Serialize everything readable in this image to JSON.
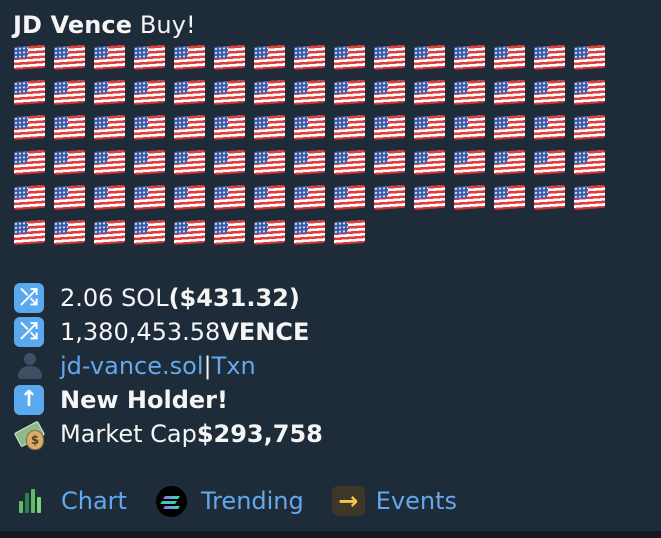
{
  "message": {
    "title": {
      "name": "JD Vence",
      "suffix": " Buy!"
    },
    "flags": {
      "count": 84,
      "per_row": 15,
      "icon": "us-flag-icon"
    },
    "details": [
      {
        "icon": "shuffle-icon",
        "text": "2.06 SOL ",
        "bold": "($431.32)",
        "link": ""
      },
      {
        "icon": "shuffle-icon",
        "text": "1,380,453.58 ",
        "bold": "VENCE",
        "link": ""
      },
      {
        "icon": "person-icon",
        "text": "",
        "bold": "",
        "link": "jd-vance.sol",
        "separator": " | ",
        "link2": "Txn"
      },
      {
        "icon": "up-arrow-icon",
        "text": "",
        "bold": "New Holder!",
        "link": ""
      },
      {
        "icon": "money-icon",
        "text": "Market Cap ",
        "bold": "$293,758",
        "link": ""
      }
    ],
    "actions": [
      {
        "icon": "chart-icon",
        "label": "Chart"
      },
      {
        "icon": "trending-icon",
        "label": "Trending"
      },
      {
        "icon": "right-arrow-icon",
        "label": "Events"
      }
    ]
  },
  "colors": {
    "background": "#1e2c3a",
    "text": "#f5f5f5",
    "link": "#64a8eb",
    "shuffle_icon": "#5aa9ee",
    "events_icon": "#f8c34a"
  }
}
